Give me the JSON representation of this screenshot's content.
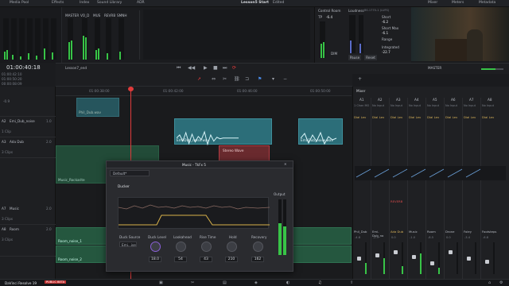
{
  "app": {
    "title": "Lesson5 Start",
    "status": "Edited",
    "product": "DaVinci Resolve 19",
    "badge": "PUBLIC BETA"
  },
  "topbar": {
    "tabs": [
      "Media Pool",
      "Effects",
      "Index",
      "Sound Library",
      "ADR"
    ],
    "right_tabs": [
      "Mixer",
      "Meters",
      "Metadata"
    ]
  },
  "meters": {
    "labels": [
      "MASTER",
      "VO_D",
      "MUS",
      "REVRB",
      "SMNH"
    ],
    "control_room": "Control Room",
    "tp": "TP",
    "tp_value": "-6.4",
    "loudness": "Loudness",
    "loudness_std": "BS.1770-1 (LUFS)",
    "short": "Short",
    "short_val": "-6.2",
    "short_max": "Short Max",
    "short_max_val": "-6.1",
    "range": "Range",
    "integrated": "Integrated",
    "integrated_val": "-22.7",
    "pause": "Pause",
    "reset": "Reset",
    "peak": "DIM"
  },
  "timecode": {
    "main": "01:00:40:18",
    "in": "01:00:42:10",
    "out": "01:00:50:20",
    "dur": "00:00:08:09"
  },
  "toolbar": {
    "timeline_name": "Lesson7_end",
    "master": "MASTER"
  },
  "ruler": {
    "t1": "01:00:38:00",
    "t2": "01:00:42:00",
    "t3": "01:00:46:00",
    "t4": "01:00:50:00"
  },
  "tracks": [
    {
      "id": "A2",
      "name": "Emi_Dub_noise",
      "val": "1.0",
      "clips": "1 Clip"
    },
    {
      "id": "A3",
      "name": "Ada Dub",
      "val": "2.0",
      "clips": "3 Clips"
    },
    {
      "id": "A7",
      "name": "Music",
      "val": "2.0",
      "clips": "3 Clips"
    },
    {
      "id": "A8",
      "name": "Room",
      "val": "2.0",
      "clips": "3 Clips"
    }
  ],
  "clips": {
    "phil_dub": "Phil_Dub.wav",
    "emi_dub": "Emi-Dub_noise.wav",
    "emi_dub2": "Emi-Dub_noise.wav",
    "stereo_wave": "Stereo Wave",
    "music": "Music_Rockarite",
    "room1": "Room_noise_1",
    "room2": "Room_noise_2"
  },
  "mixer": {
    "title": "Mixer",
    "channels": [
      "A1",
      "A2",
      "A3",
      "A4",
      "A5",
      "A6",
      "A7",
      "A8"
    ],
    "names": [
      "Phil_Dub",
      "Emi-Dub_no",
      "Ada Dub",
      "Music",
      "Room",
      "Drone",
      "Foley",
      "Footsteps"
    ],
    "inputs": [
      "1 Chan MO",
      "No Input",
      "No Input",
      "No Input",
      "No Input",
      "No Input",
      "No Input",
      "No Input"
    ],
    "fx": [
      "Dial Lev",
      "Dial Lev",
      "Dial Lev",
      "Dial Lev",
      "Dial Lev",
      "Dial Lev",
      "Dial Lev",
      "Dial Lev"
    ],
    "reverb_label": "REVERB",
    "values": [
      "-4.8",
      "-2.9",
      "0.0",
      "-1.0",
      "-8.5",
      "0.0",
      "-3.4",
      "-6.8"
    ]
  },
  "plugin": {
    "title": "Music - TkFx 5",
    "preset": "Default*",
    "section": "Ducker",
    "output": "Output",
    "controls": [
      {
        "label": "Duck Source",
        "value": "Emi...ise"
      },
      {
        "label": "Duck Level",
        "value": "18.0"
      },
      {
        "label": "Lookahead",
        "value": "54"
      },
      {
        "label": "Rise Time",
        "value": "43"
      },
      {
        "label": "Hold",
        "value": "210"
      },
      {
        "label": "Recovery",
        "value": "162"
      }
    ]
  },
  "colors": {
    "accent": "#e03b3b",
    "teal": "#2c6e79",
    "green": "#25573f",
    "meter": "#38c447",
    "purple": "#8a5fd6"
  }
}
